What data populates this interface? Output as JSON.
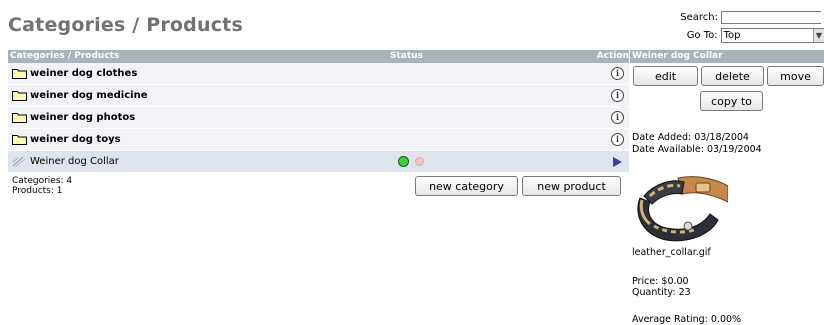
{
  "page": {
    "title": "Categories / Products"
  },
  "search": {
    "label": "Search:",
    "value": ""
  },
  "goto": {
    "label": "Go To:",
    "selected": "Top"
  },
  "listing": {
    "headers": {
      "name": "Categories / Products",
      "status": "Status",
      "action": "Action"
    },
    "categories": [
      {
        "name": "weiner dog clothes"
      },
      {
        "name": "weiner dog medicine"
      },
      {
        "name": "weiner dog photos"
      },
      {
        "name": "weiner dog toys"
      }
    ],
    "product": {
      "name": "Weiner dog Collar",
      "status": "active"
    }
  },
  "counts": {
    "categories": "Categories: 4",
    "products": "Products: 1"
  },
  "buttons": {
    "new_category": "new category",
    "new_product": "new product"
  },
  "info": {
    "title": "Weiner dog Collar",
    "edit": "edit",
    "delete": "delete",
    "move": "move",
    "copy_to": "copy to",
    "date_added": "Date Added: 03/18/2004",
    "date_available": "Date Available: 03/19/2004",
    "image_name": "leather_collar.gif",
    "price": "Price: $0.00",
    "quantity": "Quantity: 23",
    "rating": "Average Rating: 0.00%"
  },
  "colors": {
    "header_bg": "#aab3bb",
    "row_bg": "#f2f3f7",
    "selected_row_bg": "#dee4ec",
    "title": "#727272"
  }
}
